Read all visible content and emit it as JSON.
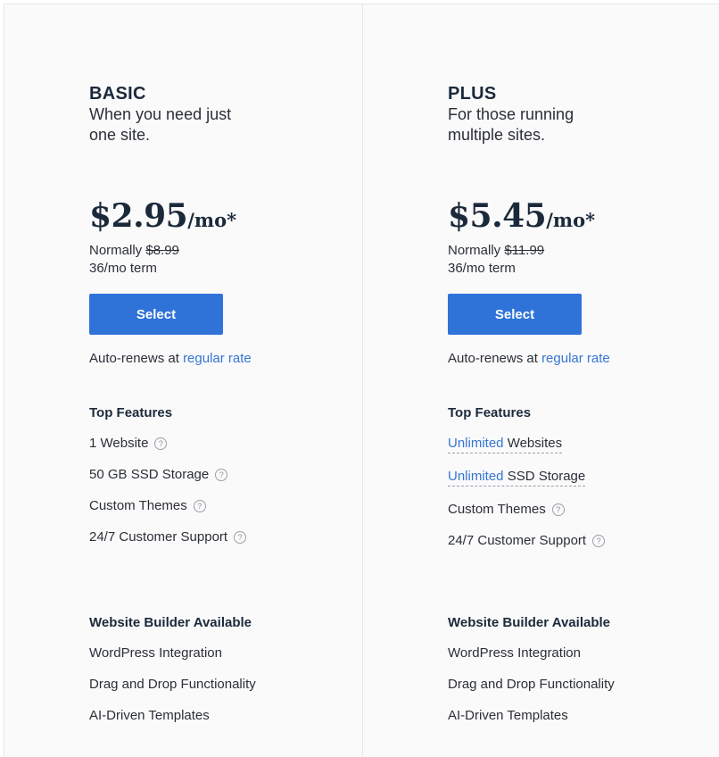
{
  "plans": [
    {
      "name": "BASIC",
      "tagline": "When you need just one site.",
      "price": "$2.95",
      "per": "/mo*",
      "normally_label": "Normally",
      "normally_price": "$8.99",
      "term": "36/mo term",
      "select_label": "Select",
      "autorenew_text": "Auto-renews at",
      "autorenew_link": "regular rate",
      "features_title": "Top Features",
      "features": [
        {
          "highlight": "",
          "text": "1 Website"
        },
        {
          "highlight": "",
          "text": "50 GB SSD Storage"
        },
        {
          "highlight": "",
          "text": "Custom Themes"
        },
        {
          "highlight": "",
          "text": "24/7 Customer Support"
        }
      ],
      "builder_title": "Website Builder Available",
      "builder_items": [
        "WordPress Integration",
        "Drag and Drop Functionality",
        "AI-Driven Templates"
      ]
    },
    {
      "name": "PLUS",
      "tagline": "For those running multiple sites.",
      "price": "$5.45",
      "per": "/mo*",
      "normally_label": "Normally",
      "normally_price": "$11.99",
      "term": "36/mo term",
      "select_label": "Select",
      "autorenew_text": "Auto-renews at",
      "autorenew_link": "regular rate",
      "features_title": "Top Features",
      "features": [
        {
          "highlight": "Unlimited",
          "text": " Websites"
        },
        {
          "highlight": "Unlimited",
          "text": " SSD Storage"
        },
        {
          "highlight": "",
          "text": "Custom Themes"
        },
        {
          "highlight": "",
          "text": "24/7 Customer Support"
        }
      ],
      "builder_title": "Website Builder Available",
      "builder_items": [
        "WordPress Integration",
        "Drag and Drop Functionality",
        "AI-Driven Templates"
      ]
    }
  ],
  "help_icon_glyph": "?",
  "colors": {
    "accent": "#2f73d9",
    "link": "#3575d3",
    "text": "#1b2a3a"
  }
}
